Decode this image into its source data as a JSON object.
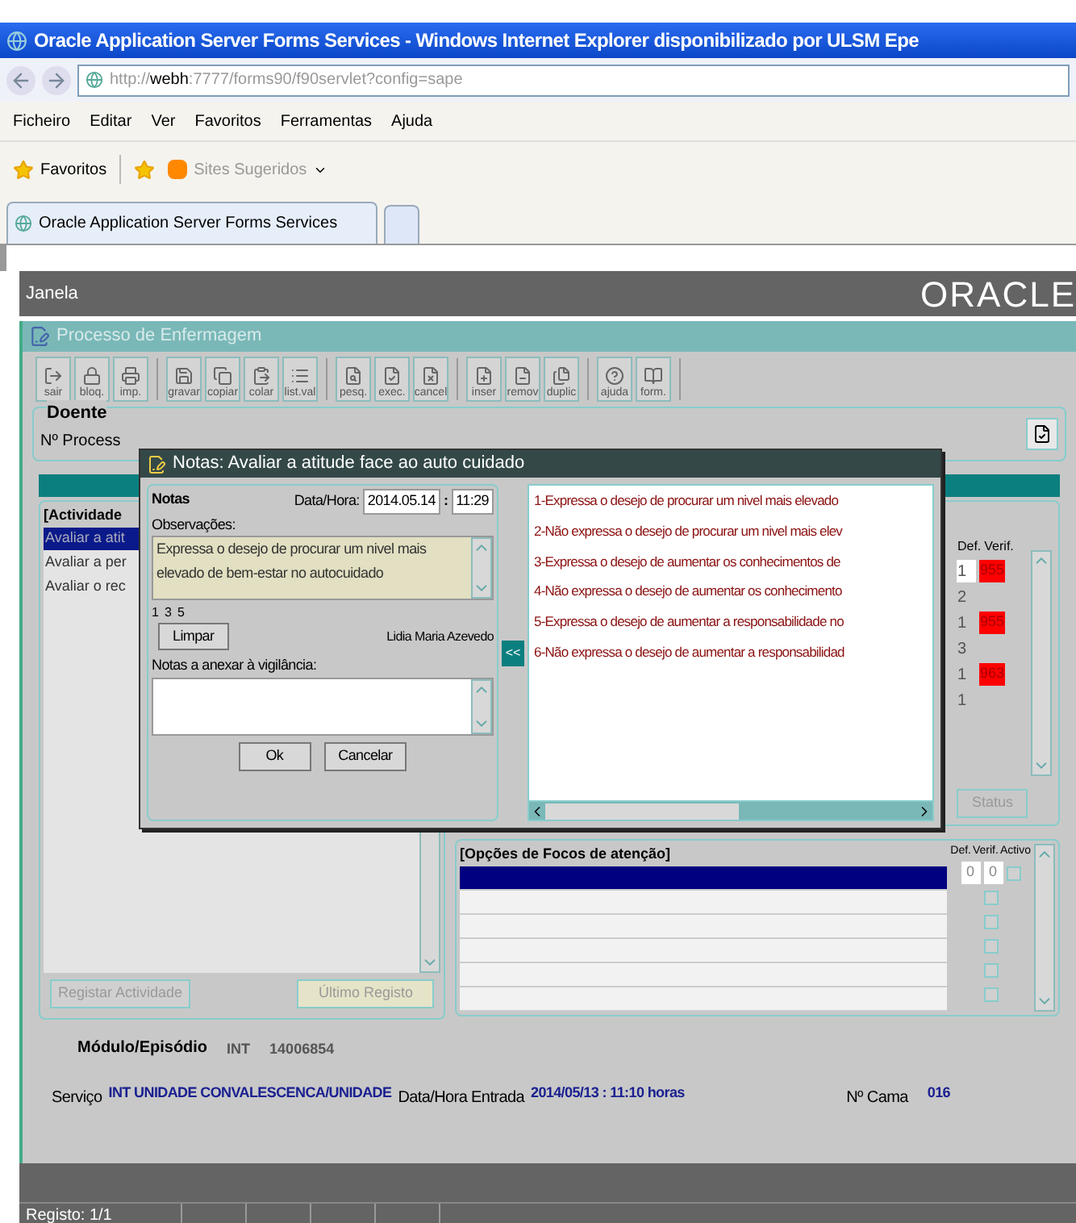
{
  "browser": {
    "title": "Oracle Application Server Forms Services - Windows Internet Explorer disponibilizado por ULSM Epe",
    "address_prefix": "http://",
    "address_host": "webh",
    "address_rest": ":7777/forms90/f90servlet?config=sape",
    "menu": [
      "Ficheiro",
      "Editar",
      "Ver",
      "Favoritos",
      "Ferramentas",
      "Ajuda"
    ],
    "favorites": "Favoritos",
    "suggested_sites": "Sites Sugeridos",
    "tab": "Oracle Application Server Forms Services"
  },
  "app": {
    "menu": "Janela",
    "logo": "ORACLE",
    "form_title": "Processo de Enfermagem",
    "toolbar": [
      [
        "sair",
        "bloq.",
        "imp."
      ],
      [
        "gravar",
        "copiar",
        "colar",
        "list.val"
      ],
      [
        "pesq.",
        "exec.",
        "cancel"
      ],
      [
        "inser",
        "remov",
        "duplic"
      ],
      [
        "ajuda",
        "form."
      ]
    ],
    "patient": {
      "section": "Doente",
      "label": "Nº Process"
    },
    "activities": {
      "title": "[Actividade",
      "items": [
        {
          "label": "Avaliar a atit",
          "selected": true
        },
        {
          "label": "Avaliar a per",
          "selected": false
        },
        {
          "label": "Avaliar o rec",
          "selected": false
        }
      ],
      "register_button": {
        "label": "Registar Actividade",
        "disabled": true
      },
      "last_record_button": {
        "label": "Último Registo"
      }
    },
    "verification": {
      "headers": [
        "Def.",
        "Verif."
      ],
      "rows": [
        {
          "def": "1",
          "verif": "955"
        },
        {
          "def": "2"
        },
        {
          "def": "1",
          "verif": "955"
        },
        {
          "def": "3"
        },
        {
          "def": "1",
          "verif": "963"
        },
        {
          "def": "1"
        }
      ],
      "status_button": "Status"
    },
    "focus_options": {
      "title": "[Opções de Focos de atenção]",
      "headers": [
        "Def.",
        "Verif.",
        "Activo"
      ],
      "rows": [
        {
          "selected": true,
          "def": "0",
          "verif": "0",
          "checked": false
        },
        {
          "selected": false,
          "checked": false
        },
        {
          "selected": false,
          "checked": false
        },
        {
          "selected": false,
          "checked": false
        },
        {
          "selected": false,
          "checked": false
        },
        {
          "selected": false,
          "checked": false
        }
      ]
    },
    "episode": {
      "label": "Módulo/Episódio",
      "module": "INT",
      "number": "14006854",
      "service_label": "Serviço",
      "service": "INT UNIDADE CONVALESCENCA/UNIDADE",
      "entry_label": "Data/Hora Entrada",
      "entry": "2014/05/13 : 11:10 horas",
      "bed_label": "Nº Cama",
      "bed": "016"
    },
    "status_bar": "Registo: 1/1"
  },
  "dialog": {
    "title": "Notas: Avaliar a atitude face ao auto cuidado",
    "section": "Notas",
    "date_label": "Data/Hora:",
    "date": "2014.05.14",
    "separator": ":",
    "time": "11:29",
    "observations_label": "Observações:",
    "observations": "Expressa o desejo de procurar um nivel mais elevado de bem-estar no autocuidado",
    "numbers": "1  3  5",
    "author": "Lidia Maria Azevedo",
    "clear_button": "Limpar",
    "notes_label": "Notas a anexar à vigilância:",
    "ok_button": "Ok",
    "cancel_button": "Cancelar",
    "transfer_button": "<<",
    "options": [
      "1-Expressa o desejo de procurar um nivel mais elevado",
      "2-Não expressa o desejo de procurar um nivel mais elev",
      "3-Expressa o desejo de aumentar os conhecimentos de",
      "4-Não expressa o desejo de aumentar os conhecimento",
      "5-Expressa o desejo de aumentar a responsabilidade no",
      "6-Não expressa o desejo de aumentar a responsabilidad"
    ]
  }
}
